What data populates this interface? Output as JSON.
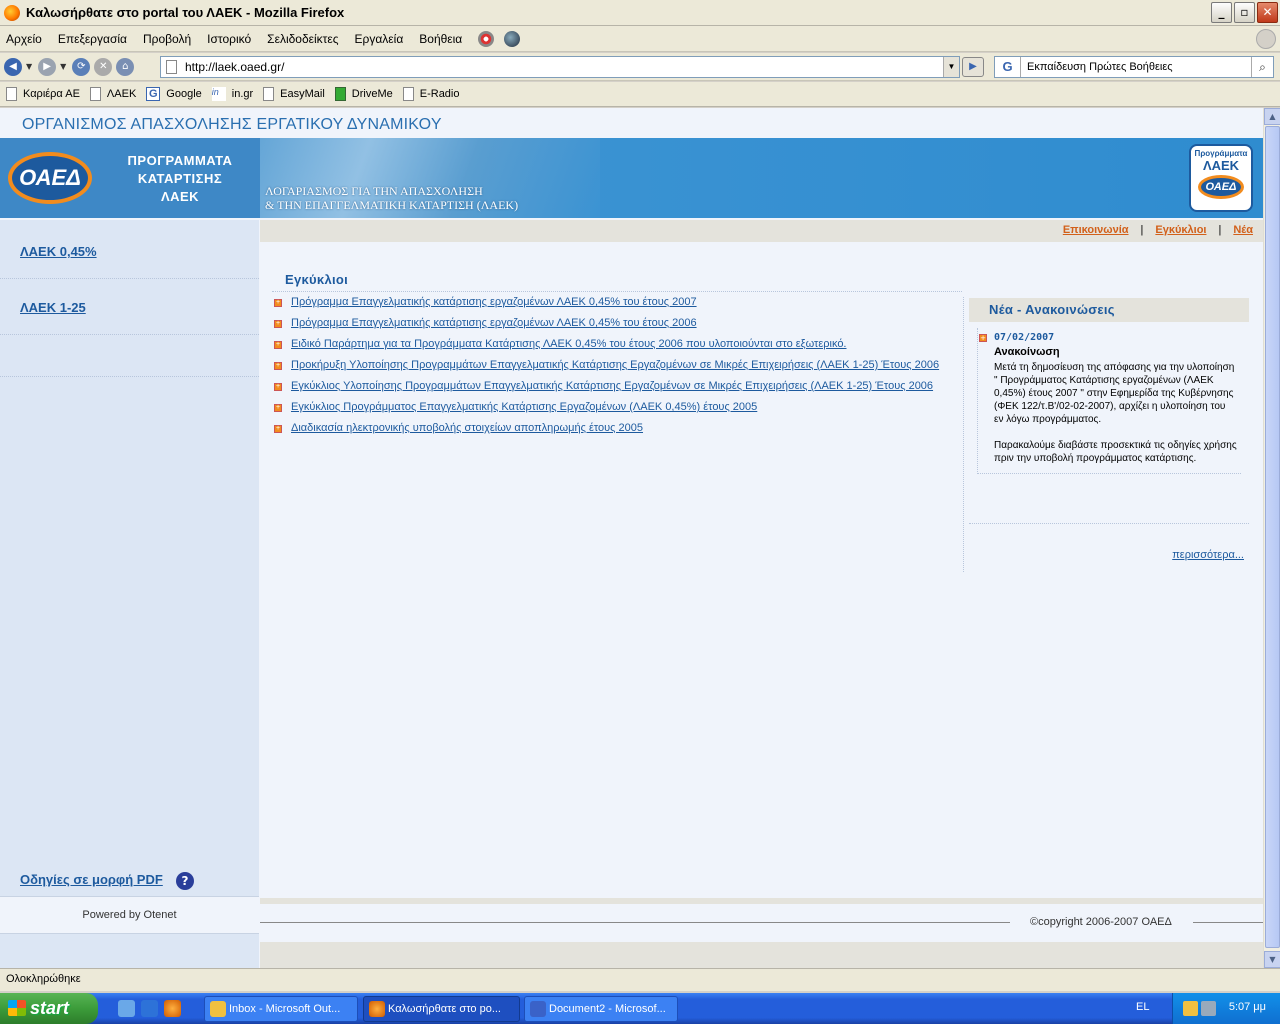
{
  "window": {
    "title": "Καλωσήρθατε στο portal του ΛΑΕΚ - Mozilla Firefox",
    "buttons": {
      "minimize": "_",
      "maximize": "▫",
      "close": "✕"
    }
  },
  "menubar": {
    "items": [
      "Αρχείο",
      "Επεξεργασία",
      "Προβολή",
      "Ιστορικό",
      "Σελιδοδείκτες",
      "Εργαλεία",
      "Βοήθεια"
    ]
  },
  "navbar": {
    "url": "http://laek.oaed.gr/",
    "search_engine": "G",
    "search_text": "Εκπαίδευση Πρώτες Βοήθειες"
  },
  "bookmarks": [
    {
      "label": "Καριέρα ΑΕ",
      "icon": "page-icon"
    },
    {
      "label": "ΛΑΕΚ",
      "icon": "page-icon"
    },
    {
      "label": "Google",
      "icon": "google-icon"
    },
    {
      "label": "in.gr",
      "icon": "ingr-icon"
    },
    {
      "label": "EasyMail",
      "icon": "page-icon"
    },
    {
      "label": "DriveMe",
      "icon": "driveme-icon"
    },
    {
      "label": "E-Radio",
      "icon": "page-icon"
    }
  ],
  "page": {
    "org_title": "ΟΡΓΑΝΙΣΜΟΣ ΑΠΑΣΧΟΛΗΣΗΣ ΕΡΓΑΤΙΚΟΥ ΔΥΝΑΜΙΚΟΥ",
    "banner": {
      "logo_text": "ΟΑΕΔ",
      "program_title_lines": [
        "ΠΡΟΓΡΑΜΜΑΤΑ",
        "ΚΑΤΑΡΤΙΣΗΣ",
        "ΛΑΕΚ"
      ],
      "tagline_lines": [
        "ΛΟΓΑΡΙΑΣΜΟΣ ΓΙΑ ΤΗΝ ΑΠΑΣΧΟΛΗΣΗ",
        "& ΤΗΝ ΕΠΑΓΓΕΛΜΑΤΙΚΗ ΚΑΤΑΡΤΙΣΗ (ΛΑΕΚ)"
      ],
      "badge": {
        "top": "Προγράμματα",
        "mid": "ΛΑΕΚ",
        "logo": "ΟΑΕΔ"
      }
    },
    "sidebar": {
      "links": [
        "ΛΑΕΚ 0,45%",
        "ΛΑΕΚ 1-25"
      ],
      "pdf_link": "Οδηγίες σε μορφή PDF",
      "powered_by": "Powered by Otenet"
    },
    "top_links": [
      "Επικοινωνία",
      "Εγκύκλιοι",
      "Νέα"
    ],
    "circulars": {
      "heading": "Εγκύκλιοι",
      "items": [
        "Πρόγραμμα Επαγγελματικής κατάρτισης εργαζομένων ΛΑΕΚ 0,45% του έτους 2007",
        "Πρόγραμμα Επαγγελματικής κατάρτισης εργαζομένων ΛΑΕΚ 0,45% του έτους 2006",
        "Ειδικό Παράρτημα για τα Προγράμματα Κατάρτισης ΛΑΕΚ 0,45% του έτους 2006 που υλοποιούνται στο εξωτερικό.",
        "Προκήρυξη Υλοποίησης Προγραμμάτων Επαγγελματικής Κατάρτισης Εργαζομένων σε Μικρές Επιχειρήσεις (ΛΑΕΚ 1-25) Έτους 2006",
        "Εγκύκλιος Υλοποίησης Προγραμμάτων Επαγγελματικής Κατάρτισης Εργαζομένων σε Μικρές Επιχειρήσεις (ΛΑΕΚ 1-25) Έτους 2006",
        "Εγκύκλιος Προγράμματος Επαγγελματικής Κατάρτισης Εργαζομένων (ΛΑΕΚ 0,45%) έτους 2005",
        "Διαδικασία ηλεκτρονικής υποβολής στοιχείων αποπληρωμής έτους 2005"
      ]
    },
    "news": {
      "heading": "Νέα - Ανακοινώσεις",
      "date": "07/02/2007",
      "title": "Ανακοίνωση",
      "body_p1": "Μετά τη δημοσίευση της απόφασης για την υλοποίηση \" Προγράμματος Κατάρτισης εργαζομένων (ΛΑΕΚ 0,45%) έτους 2007 \" στην Εφημερίδα της Κυβέρνησης (ΦΕΚ 122/τ.Β'/02-02-2007), αρχίζει η υλοποίηση του εν λόγω προγράμματος.",
      "body_p2": "Παρακαλούμε διαβάστε προσεκτικά τις οδηγίες χρήσης πριν την υποβολή προγράμματος κατάρτισης.",
      "more": "περισσότερα..."
    },
    "copyright": "©copyright 2006-2007 ΟΑΕΔ"
  },
  "status": "Ολοκληρώθηκε",
  "taskbar": {
    "start": "start",
    "tasks": [
      {
        "label": "Inbox - Microsoft Out...",
        "active": false
      },
      {
        "label": "Καλωσήρθατε στο po...",
        "active": true
      },
      {
        "label": "Document2 - Microsof...",
        "active": false
      }
    ],
    "language": "EL",
    "clock": "5:07 μμ"
  },
  "colors": {
    "accent_link": "#1d5a9e",
    "orange_link": "#d2601a",
    "banner_blue": "#3b93d3",
    "logo_orange": "#f28c1e"
  }
}
